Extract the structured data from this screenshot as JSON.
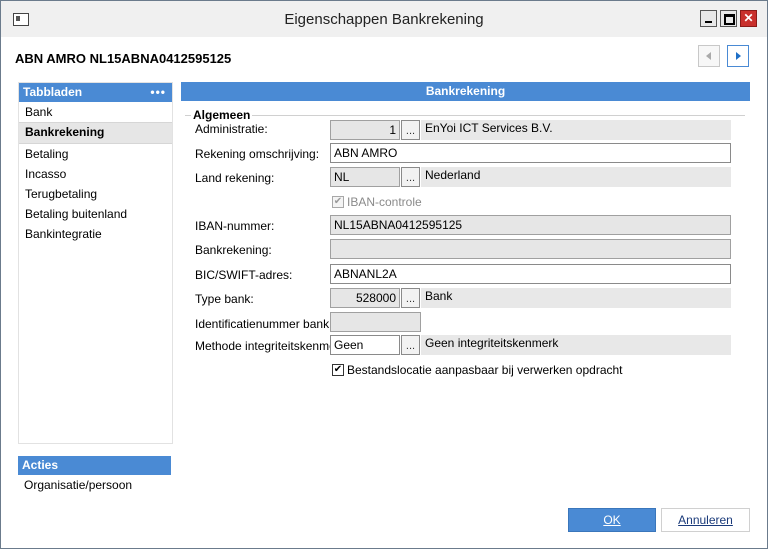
{
  "window": {
    "title": "Eigenschappen Bankrekening",
    "close_glyph": "✕"
  },
  "header": {
    "name": "ABN AMRO NL15ABNA0412595125"
  },
  "tabs_panel": {
    "title": "Tabbladen",
    "menu_glyph": "•••",
    "items": [
      "Bank",
      "Bankrekening",
      "Betaling",
      "Incasso",
      "Terugbetaling",
      "Betaling buitenland",
      "Bankintegratie"
    ],
    "active_index": 1
  },
  "actions_panel": {
    "title": "Acties",
    "items": [
      "Organisatie/persoon"
    ]
  },
  "main": {
    "title": "Bankrekening",
    "group_title": "Algemeen",
    "administratie": {
      "label": "Administratie:",
      "value": "1",
      "description": "EnYoi ICT Services B.V."
    },
    "omschrijving": {
      "label": "Rekening omschrijving:",
      "value": "ABN AMRO"
    },
    "land": {
      "label": "Land rekening:",
      "value": "NL",
      "description": "Nederland"
    },
    "iban_controle": {
      "label": "IBAN-controle",
      "checked": true,
      "enabled": false
    },
    "iban": {
      "label": "IBAN-nummer:",
      "value": "NL15ABNA0412595125"
    },
    "bankrekening": {
      "label": "Bankrekening:",
      "value": ""
    },
    "bic": {
      "label": "BIC/SWIFT-adres:",
      "value": "ABNANL2A"
    },
    "type_bank": {
      "label": "Type bank:",
      "value": "528000",
      "description": "Bank"
    },
    "identificatie": {
      "label": "Identificatienummer bank:",
      "value": ""
    },
    "methode": {
      "label": "Methode integriteitskenmerk:",
      "value": "Geen",
      "description": "Geen integriteitskenmerk"
    },
    "bestandslocatie": {
      "label": "Bestandslocatie aanpasbaar bij verwerken opdracht",
      "checked": true
    }
  },
  "buttons": {
    "ok": "OK",
    "cancel": "Annuleren"
  },
  "lookup_glyph": "...",
  "check_glyph": "✔",
  "colors": {
    "accent": "#4a8ad4",
    "close": "#c9302c"
  }
}
